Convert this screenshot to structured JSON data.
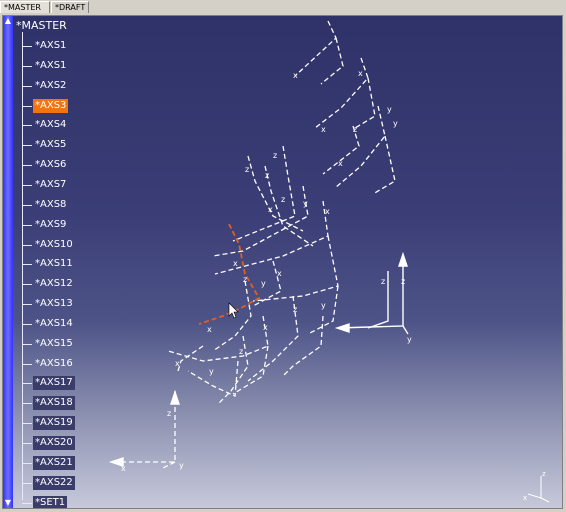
{
  "tabs": [
    {
      "label": "*MASTER",
      "active": true
    },
    {
      "label": "*DRAFT",
      "active": false
    }
  ],
  "scroll": {
    "up": "▲",
    "down": "▼"
  },
  "tree": {
    "root": "*MASTER",
    "items": [
      {
        "label": "*AXS1",
        "state": "plain"
      },
      {
        "label": "*AXS1",
        "state": "plain"
      },
      {
        "label": "*AXS2",
        "state": "plain"
      },
      {
        "label": "*AXS3",
        "state": "selected"
      },
      {
        "label": "*AXS4",
        "state": "plain"
      },
      {
        "label": "*AXS5",
        "state": "plain"
      },
      {
        "label": "*AXS6",
        "state": "plain"
      },
      {
        "label": "*AXS7",
        "state": "plain"
      },
      {
        "label": "*AXS8",
        "state": "plain"
      },
      {
        "label": "*AXS9",
        "state": "plain"
      },
      {
        "label": "*AXS10",
        "state": "plain"
      },
      {
        "label": "*AXS11",
        "state": "plain"
      },
      {
        "label": "*AXS12",
        "state": "plain"
      },
      {
        "label": "*AXS13",
        "state": "plain"
      },
      {
        "label": "*AXS14",
        "state": "plain"
      },
      {
        "label": "*AXS15",
        "state": "plain"
      },
      {
        "label": "*AXS16",
        "state": "plain"
      },
      {
        "label": "*AXS17",
        "state": "boxed"
      },
      {
        "label": "*AXS18",
        "state": "boxed"
      },
      {
        "label": "*AXS19",
        "state": "boxed"
      },
      {
        "label": "*AXS20",
        "state": "boxed"
      },
      {
        "label": "*AXS21",
        "state": "boxed"
      },
      {
        "label": "*AXS22",
        "state": "boxed"
      },
      {
        "label": "*SET1",
        "state": "boxed"
      }
    ]
  },
  "colors": {
    "selected": "#f07410",
    "axis_lines": "#ffffff",
    "selected_axis": "#e06020"
  }
}
